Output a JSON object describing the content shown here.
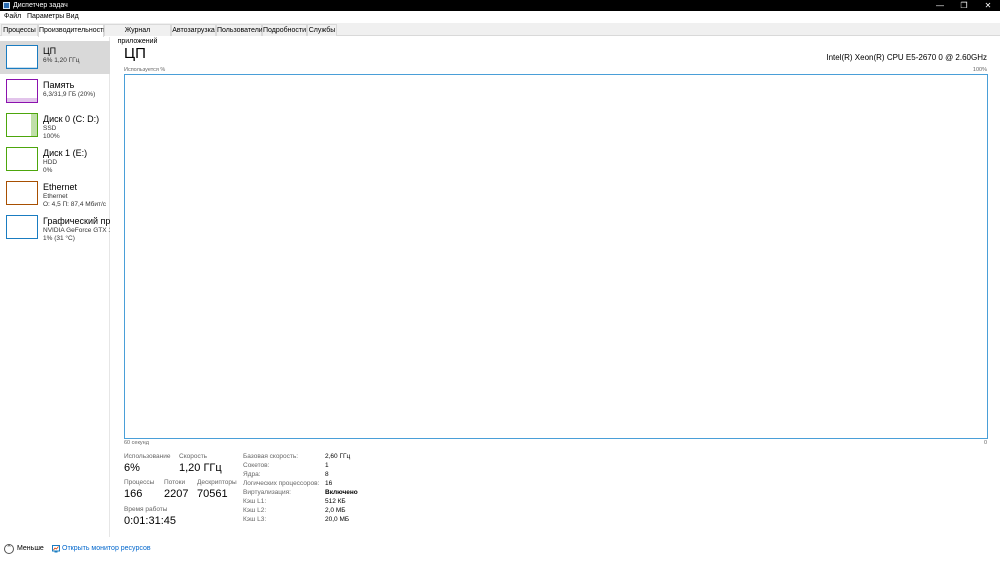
{
  "window": {
    "title": "Диспетчер задач",
    "min": "—",
    "max": "❐",
    "close": "✕"
  },
  "menu": [
    "Файл",
    "Параметры",
    "Вид"
  ],
  "tabs": [
    "Процессы",
    "Производительность",
    "Журнал приложений",
    "Автозагрузка",
    "Пользователи",
    "Подробности",
    "Службы"
  ],
  "sidebar": [
    {
      "name": "ЦП",
      "line1": "6% 1,20 ГГц",
      "line2": "",
      "color": "#1a7cc1",
      "fill": 0.06
    },
    {
      "name": "Память",
      "line1": "6,3/31,9 ГБ (20%)",
      "line2": "",
      "color": "#8b12ae",
      "fill": 0.2
    },
    {
      "name": "Диск 0 (C: D:)",
      "line1": "SSD",
      "line2": "100%",
      "color": "#4da60c",
      "fill": 1.0
    },
    {
      "name": "Диск 1 (E:)",
      "line1": "HDD",
      "line2": "0%",
      "color": "#4da60c",
      "fill": 0.0
    },
    {
      "name": "Ethernet",
      "line1": "Ethernet",
      "line2": "О: 4,5  П: 87,4 Мбит/с",
      "color": "#a74f01",
      "fill": 0.0
    },
    {
      "name": "Графический процессор 0",
      "line1": "NVIDIA GeForce GTX 1660",
      "line2": "1% (31 °C)",
      "color": "#1a7cc1",
      "fill": 0.01
    }
  ],
  "cpu": {
    "title": "ЦП",
    "model": "Intel(R) Xeon(R) CPU E5-2670 0 @ 2.60GHz",
    "usage_label": "Используется %",
    "usage_max": "100%",
    "time_left": "60 секунд",
    "time_right": "0",
    "graph_color": "#4a9fd8",
    "history": [
      0,
      0,
      0,
      0,
      0,
      0,
      0,
      0,
      0,
      0,
      0,
      0,
      0,
      0,
      0,
      0,
      0,
      0,
      0,
      0,
      0,
      0,
      0,
      0,
      0,
      0,
      0,
      0,
      0,
      0,
      0,
      0,
      0,
      0,
      0,
      0,
      0,
      0,
      0,
      0,
      0,
      0,
      0,
      0,
      0,
      0,
      0,
      0,
      0,
      0,
      0,
      0,
      0,
      5.5,
      7,
      8,
      6,
      5,
      1.5,
      1,
      1,
      2,
      3,
      5.5
    ]
  },
  "stats": {
    "usage_label": "Использование",
    "usage": "6%",
    "speed_label": "Скорость",
    "speed": "1,20 ГГц",
    "processes_label": "Процессы",
    "processes": "166",
    "threads_label": "Потоки",
    "threads": "2207",
    "handles_label": "Дескрипторы",
    "handles": "70561",
    "uptime_label": "Время работы",
    "uptime": "0:01:31:45"
  },
  "details": [
    {
      "label": "Базовая скорость:",
      "value": "2,60 ГГц"
    },
    {
      "label": "Сокетов:",
      "value": "1"
    },
    {
      "label": "Ядра:",
      "value": "8"
    },
    {
      "label": "Логических процессоров:",
      "value": "16"
    },
    {
      "label": "Виртуализация:",
      "value": "Включено"
    },
    {
      "label": "Кэш L1:",
      "value": "512 КБ"
    },
    {
      "label": "Кэш L2:",
      "value": "2,0 МБ"
    },
    {
      "label": "Кэш L3:",
      "value": "20,0 МБ"
    }
  ],
  "footer": {
    "fewer": "Меньше",
    "monitor": "Открыть монитор ресурсов",
    "fewer_icon": "⌃"
  }
}
